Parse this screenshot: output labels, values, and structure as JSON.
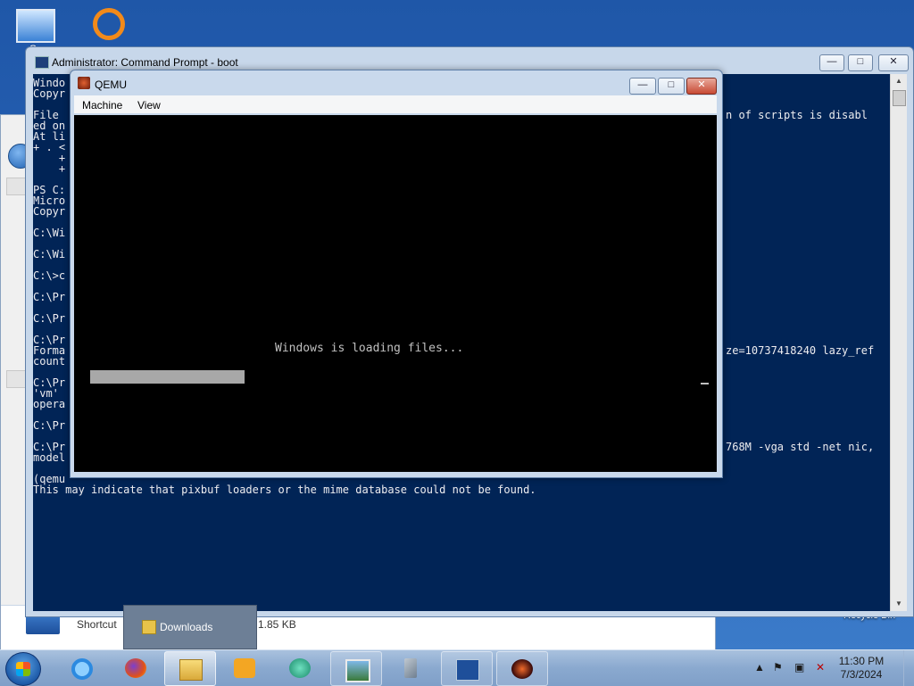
{
  "desktop": {
    "computer_icon_label": "Co",
    "recycle_label": "Recycle Bin"
  },
  "explorer": {
    "status_label": "Shortcut",
    "status_size": "1.85 KB"
  },
  "cmd": {
    "title": "Administrator: Command Prompt - boot",
    "lines": [
      "Windo",
      "Copyr",
      "",
      "File ",
      "ed on",
      "At li",
      "+ . <",
      "    +",
      "    +",
      "",
      "PS C:",
      "Micro",
      "Copyr",
      "",
      "C:\\Wi",
      "",
      "C:\\Wi",
      "",
      "C:\\>c",
      "",
      "C:\\Pr",
      "",
      "C:\\Pr",
      "",
      "C:\\Pr",
      "Forma",
      "count",
      "",
      "C:\\Pr",
      "'vm' ",
      "opera",
      "",
      "C:\\Pr",
      "",
      "C:\\Pr",
      "model",
      "",
      "(qemu",
      "This may indicate that pixbuf loaders or the mime database could not be found."
    ],
    "right_fragments": [
      {
        "row": 3,
        "text": "n of scripts is disabl"
      },
      {
        "row": 25,
        "text": "ze=10737418240 lazy_ref"
      },
      {
        "row": 34,
        "text": "768M -vga std -net nic,"
      }
    ]
  },
  "qemu": {
    "title": "QEMU",
    "menus": [
      "Machine",
      "View"
    ],
    "screen_text": "Windows is loading files...",
    "progress_fraction": 0.24
  },
  "taskbar": {
    "jump_label": "Downloads",
    "clock_time": "11:30 PM",
    "clock_date": "7/3/2024",
    "window_buttons": [
      "—",
      "□",
      "✕"
    ]
  }
}
